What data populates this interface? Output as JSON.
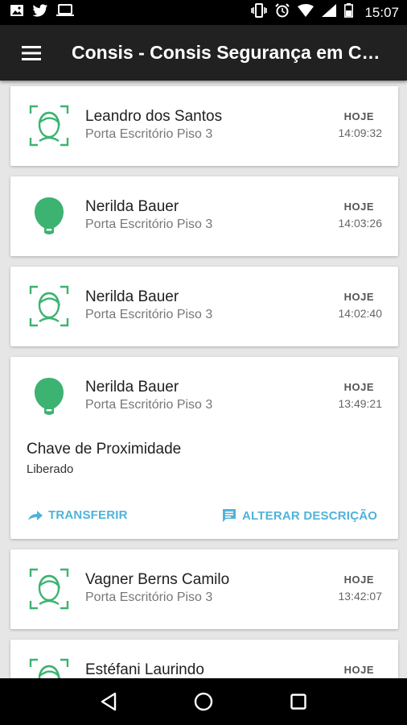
{
  "status_bar": {
    "time": "15:07"
  },
  "app_bar": {
    "title": "Consis - Consis Segurança em Co…"
  },
  "colors": {
    "accent_green": "#3cb371",
    "action_blue": "#4fb3d9",
    "app_bar": "#212121"
  },
  "events": [
    {
      "name": "Leandro dos Santos",
      "place": "Porta Escritório Piso 3",
      "day": "HOJE",
      "time": "14:09:32",
      "icon": "face-recognition-icon"
    },
    {
      "name": "Nerilda Bauer",
      "place": "Porta Escritório Piso 3",
      "day": "HOJE",
      "time": "14:03:26",
      "icon": "proximity-tag-icon"
    },
    {
      "name": "Nerilda Bauer",
      "place": "Porta Escritório Piso 3",
      "day": "HOJE",
      "time": "14:02:40",
      "icon": "face-recognition-icon"
    },
    {
      "name": "Nerilda Bauer",
      "place": "Porta Escritório Piso 3",
      "day": "HOJE",
      "time": "13:49:21",
      "icon": "proximity-tag-icon",
      "detail_type": "Chave de Proximidade",
      "detail_status": "Liberado",
      "actions": {
        "transfer": "TRANSFERIR",
        "edit_description": "ALTERAR DESCRIÇÃO"
      }
    },
    {
      "name": "Vagner Berns Camilo",
      "place": "Porta Escritório Piso 3",
      "day": "HOJE",
      "time": "13:42:07",
      "icon": "face-recognition-icon"
    },
    {
      "name": "Estéfani Laurindo",
      "place": "",
      "day": "HOJE",
      "time": "",
      "icon": "face-recognition-icon"
    }
  ]
}
